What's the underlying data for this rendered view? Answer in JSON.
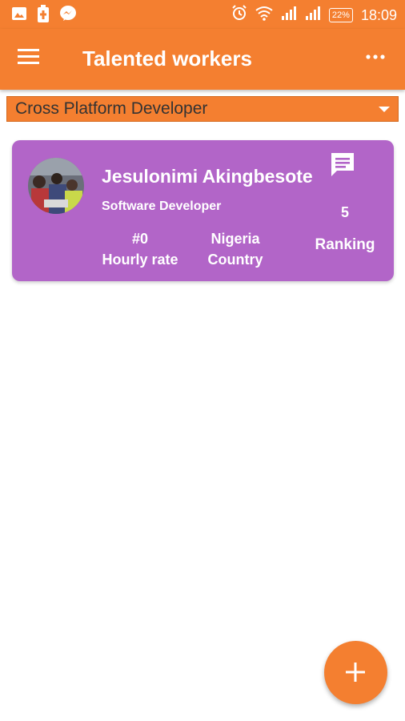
{
  "status_bar": {
    "time": "18:09",
    "battery": "22%",
    "icons": [
      "image-icon",
      "battery-charging-icon",
      "messenger-icon",
      "alarm-icon",
      "wifi-icon",
      "signal-icon",
      "signal-icon"
    ]
  },
  "app_bar": {
    "title": "Talented workers",
    "menu_icon": "hamburger-icon",
    "more_icon": "more-horizontal-icon"
  },
  "filter": {
    "selected": "Cross Platform Developer"
  },
  "workers": [
    {
      "name": "Jesulonimi Akingbesote",
      "title": "Software Developer",
      "hourly_rate_value": "#0",
      "hourly_rate_label": "Hourly rate",
      "country_value": "Nigeria",
      "country_label": "Country",
      "ranking_value": "5",
      "ranking_label": "Ranking",
      "chat_icon": "chat-icon"
    }
  ],
  "fab": {
    "icon": "add-icon"
  },
  "colors": {
    "primary": "#f47f30",
    "card": "#b265c8",
    "background": "#ffffff"
  }
}
